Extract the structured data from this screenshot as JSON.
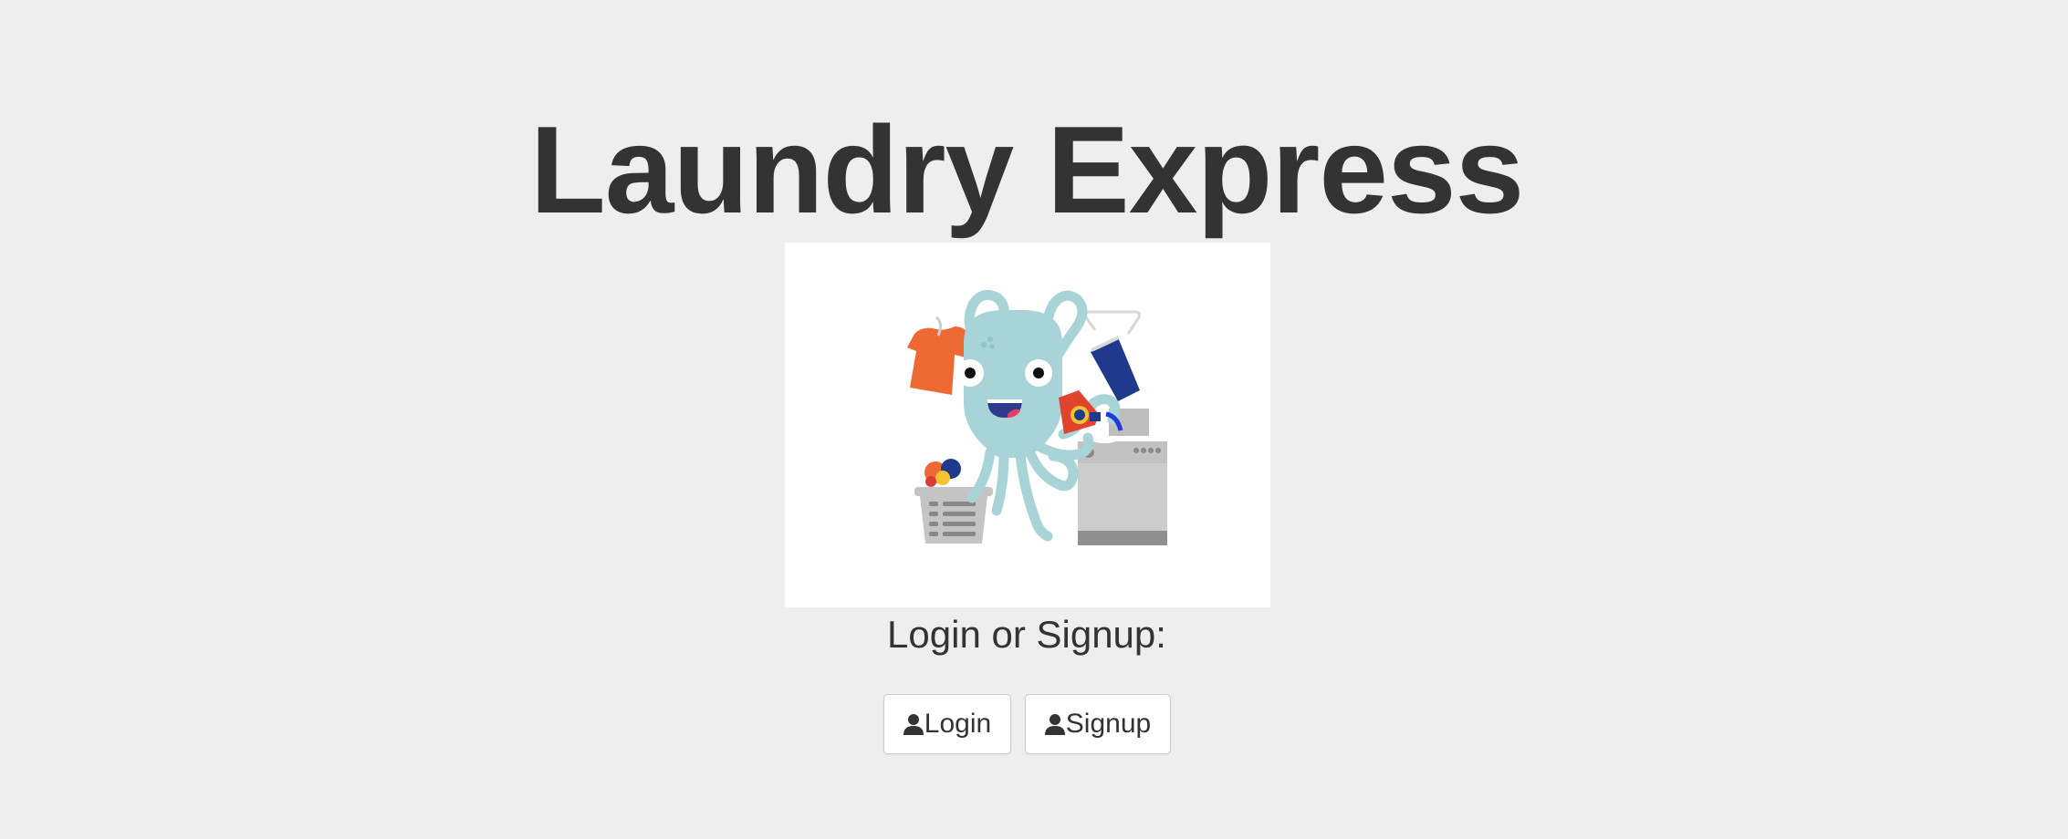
{
  "header": {
    "title": "Laundry Express"
  },
  "hero": {
    "image": "octopus-doing-laundry-illustration"
  },
  "auth": {
    "prompt": "Login or Signup:",
    "login_label": "Login",
    "signup_label": "Signup",
    "icon": "user-icon"
  },
  "colors": {
    "background": "#eeeeee",
    "text": "#333333",
    "button_border": "#cccccc",
    "octopus": "#a8d4d8",
    "shirt": "#ee6a34",
    "blue_garment": "#1f3a8c",
    "washer": "#cccccc"
  }
}
